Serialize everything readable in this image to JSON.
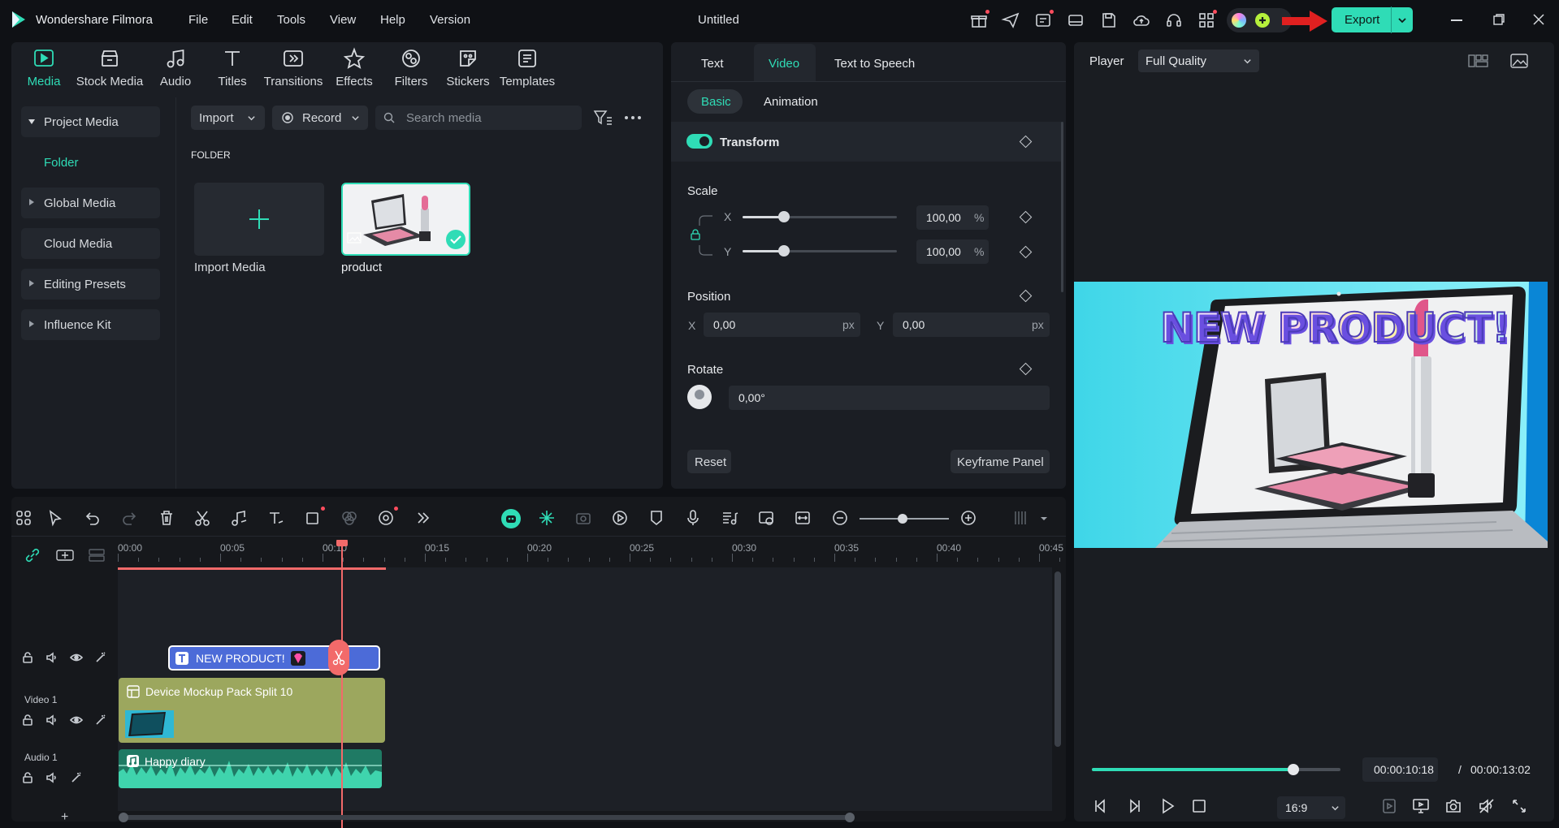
{
  "app": {
    "name": "Wondershare Filmora",
    "document_title": "Untitled",
    "menu": [
      "File",
      "Edit",
      "Tools",
      "View",
      "Help",
      "Version"
    ],
    "export_label": "Export",
    "accent": "#2fdcb6"
  },
  "media_panel": {
    "tabs": [
      "Media",
      "Stock Media",
      "Audio",
      "Titles",
      "Transitions",
      "Effects",
      "Filters",
      "Stickers",
      "Templates"
    ],
    "active_tab": "Media",
    "sidebar": {
      "project_media": "Project Media",
      "folder": "Folder",
      "global_media": "Global Media",
      "cloud_media": "Cloud Media",
      "editing_presets": "Editing Presets",
      "influence_kit": "Influence Kit"
    },
    "import_label": "Import",
    "record_label": "Record",
    "search_placeholder": "Search media",
    "folder_heading": "FOLDER",
    "import_media_label": "Import Media",
    "product_label": "product"
  },
  "properties": {
    "tabs": [
      "Text",
      "Video",
      "Text to Speech"
    ],
    "active_tab": "Video",
    "subtabs": [
      "Basic",
      "Animation"
    ],
    "active_subtab": "Basic",
    "transform_label": "Transform",
    "scale_label": "Scale",
    "scale_x_label": "X",
    "scale_y_label": "Y",
    "scale_x": "100,00",
    "scale_y": "100,00",
    "percent": "%",
    "position_label": "Position",
    "pos_x_label": "X",
    "pos_y_label": "Y",
    "pos_x": "0,00",
    "pos_y": "0,00",
    "px": "px",
    "rotate_label": "Rotate",
    "rotate_value": "0,00°",
    "reset_label": "Reset",
    "keyframe_label": "Keyframe Panel"
  },
  "player": {
    "label": "Player",
    "quality": "Full Quality",
    "overlay_title": "NEW PRODUCT!",
    "current_time": "00:00:10:18",
    "separator": "/",
    "total_time": "00:00:13:02",
    "progress": 0.81,
    "aspect": "16:9"
  },
  "timeline": {
    "ruler": [
      "00:00",
      "00:05",
      "00:10",
      "00:15",
      "00:20",
      "00:25",
      "00:30",
      "00:35",
      "00:40",
      "00:45"
    ],
    "video_track_label": "Video 1",
    "audio_track_label": "Audio 1",
    "title_clip": "NEW PRODUCT!",
    "video_clip": "Device Mockup Pack Split 10",
    "audio_clip": "Happy diary",
    "add_track": "+"
  }
}
